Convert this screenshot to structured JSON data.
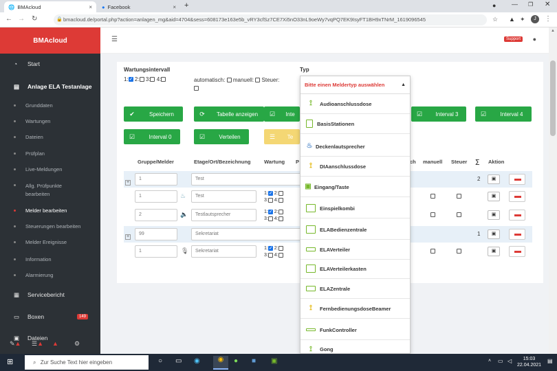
{
  "browser": {
    "tabs": [
      {
        "label": "BMAcloud",
        "close": "×"
      },
      {
        "label": "Facebook",
        "close": "×"
      }
    ],
    "new_tab": "+",
    "url": "bmacloud.de/portal.php?action=anlagen_mg&aid=4704&sess=608173e163e5b_vRY3cfSz7CE7Xi5nO33nL9oeWy7vqPQ7EK9IsyFT1BH9xTNrM_1619096545",
    "profile": "J"
  },
  "sidebar": {
    "brand": "BMAcloud",
    "items": [
      {
        "label": "Start"
      },
      {
        "label": "Anlage ELA Testanlage"
      },
      {
        "label": "Grunddaten"
      },
      {
        "label": "Wartungen"
      },
      {
        "label": "Dateien"
      },
      {
        "label": "Prüfplan"
      },
      {
        "label": "Live-Meldungen"
      },
      {
        "label": "Allg. Prüfpunkte bearbeiten"
      },
      {
        "label": "Melder bearbeiten"
      },
      {
        "label": "Steuerungen bearbeiten"
      },
      {
        "label": "Melder Ereignisse"
      },
      {
        "label": "Information"
      },
      {
        "label": "Alarmierung"
      },
      {
        "label": "Servicebericht"
      },
      {
        "label": "Boxen",
        "badge": "149"
      },
      {
        "label": "Dateien"
      }
    ]
  },
  "header": {
    "support": "Support"
  },
  "form": {
    "wartung_label": "Wartungsintervall",
    "wartung_opts": [
      "1:",
      "2:",
      "3:",
      "4:"
    ],
    "auto_label": "automatisch:",
    "manuell_label": "manuell:",
    "steuer_label": "Steuer:",
    "typ_label": "Typ"
  },
  "buttons": {
    "speichern": "Speichern",
    "tabelle": "Tabelle anzeigen",
    "inter": "Inte",
    "interval3": "Interval 3",
    "interval4": "Interval 4",
    "interval0": "Interval 0",
    "verteilen": "Verteilen",
    "te": "Te"
  },
  "table": {
    "headers": [
      "Gruppe/Melder",
      "Etage/Ort/Bezeichnung",
      "Wartung",
      "P",
      "ch",
      "manuell",
      "Steuer",
      "∑",
      "Aktion"
    ],
    "rows": [
      {
        "num": "1",
        "text": "Test",
        "sum": "2",
        "type": "group"
      },
      {
        "num": "1",
        "text": "Test",
        "w1": "1:",
        "w2": "2:",
        "w3": "3:",
        "w4": "4:",
        "type": "melder"
      },
      {
        "num": "2",
        "text": "Testlautsprecher",
        "w1": "1:",
        "w2": "2:",
        "w3": "3:",
        "w4": "4:",
        "type": "melder"
      },
      {
        "num": "99",
        "text": "Sekretariat",
        "sum": "1",
        "type": "group"
      },
      {
        "num": "1",
        "text": "Sekretariat",
        "w1": "1:",
        "w2": "2:",
        "w3": "3:",
        "w4": "4:",
        "type": "melder"
      }
    ]
  },
  "dropdown": {
    "placeholder": "Bitte einen Meldertyp auswählen",
    "options": [
      "Audioanschlussdose",
      "BasisStationen",
      "Deckenlautsprecher",
      "DIAanschlussdose",
      "Eingang/Taste",
      "Einspielkombi",
      "ELABedienzentrale",
      "ELAVerteiler",
      "ELAVerteilerkasten",
      "ELAZentrale",
      "FernbedienungsdoseBeamer",
      "FunkController",
      "Gong"
    ]
  },
  "taskbar": {
    "search": "Zur Suche Text hier eingeben",
    "time": "15:03",
    "date": "22.04.2021"
  },
  "colors": {
    "brand_red": "#dd3a36",
    "sidebar_bg": "#2c3136",
    "green": "#28a745",
    "icon_green": "#76b82a"
  }
}
